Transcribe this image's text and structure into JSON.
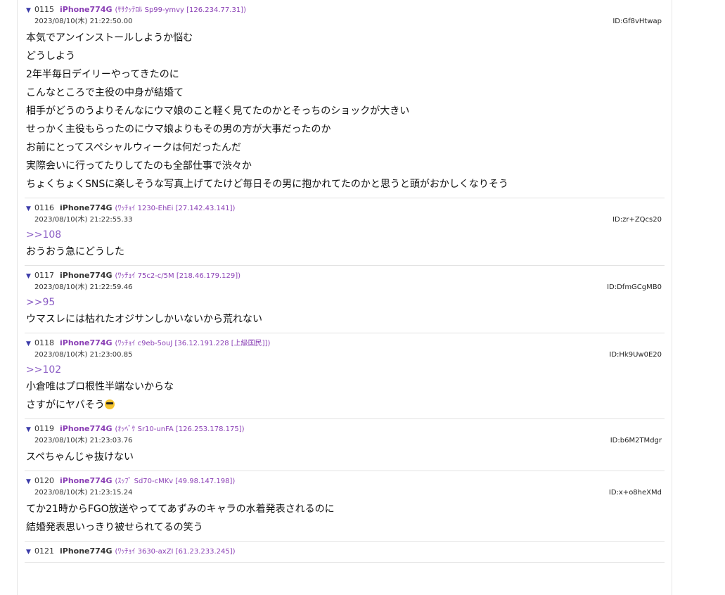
{
  "posts": [
    {
      "toggle": "▼",
      "number": "0115",
      "name": "iPhone774G",
      "trip": "(ｻｻｸｯﾃﾛﾙ Sp99-ymvy [126.234.77.31])",
      "date": "2023/08/10(木) 21:22:50.00",
      "id": "ID:Gf8vHtwap",
      "anchor": "",
      "lines": [
        "本気でアンインストールしようか悩む",
        "どうしよう",
        "2年半毎日デイリーやってきたのに",
        "こんなところで主役の中身が結婚て",
        "相手がどうのうよりそんなにウマ娘のこと軽く見てたのかとそっちのショックが大きい",
        "せっかく主役もらったのにウマ娘よりもその男の方が大事だったのか",
        "お前にとってスペシャルウィークは何だったんだ",
        "実際会いに行ってたりしてたのも全部仕事で渋々か",
        "ちょくちょくSNSに楽しそうな写真上げてたけど毎日その男に抱かれてたのかと思うと頭がおかしくなりそう"
      ]
    },
    {
      "toggle": "▼",
      "number": "0116",
      "name": "iPhone774G",
      "trip": "(ﾜｯﾁｮｲ 1230-EhEi [27.142.43.141])",
      "date": "2023/08/10(木) 21:22:55.33",
      "id": "ID:zr+ZQcs20",
      "anchor": ">>108",
      "lines": [
        "おうおう急にどうした"
      ]
    },
    {
      "toggle": "▼",
      "number": "0117",
      "name": "iPhone774G",
      "trip": "(ﾜｯﾁｮｲ 75c2-c/5M [218.46.179.129])",
      "date": "2023/08/10(木) 21:22:59.46",
      "id": "ID:DfmGCgMB0",
      "anchor": ">>95",
      "lines": [
        "ウマスレには枯れたオジサンしかいないから荒れない"
      ]
    },
    {
      "toggle": "▼",
      "number": "0118",
      "name": "iPhone774G",
      "trip": "(ﾜｯﾁｮｲ c9eb-5ouJ [36.12.191.228 [上級国民]])",
      "date": "2023/08/10(木) 21:23:00.85",
      "id": "ID:Hk9Uw0E20",
      "anchor": ">>102",
      "lines": [
        "小倉唯はプロ根性半端ないからな",
        "さすがにヤバそう"
      ],
      "emoji_line_index": 1,
      "emoji_icon": "sunglasses-face-icon"
    },
    {
      "toggle": "▼",
      "number": "0119",
      "name": "iPhone774G",
      "trip": "(ｵｯﾍﾟｹ Sr10-unFA [126.253.178.175])",
      "date": "2023/08/10(木) 21:23:03.76",
      "id": "ID:b6M2TMdgr",
      "anchor": "",
      "lines": [
        "スペちゃんじゃ抜けない"
      ]
    },
    {
      "toggle": "▼",
      "number": "0120",
      "name": "iPhone774G",
      "trip": "(ｽｯﾌﾟ Sd70-cMKv [49.98.147.198])",
      "date": "2023/08/10(木) 21:23:15.24",
      "id": "ID:x+o8heXMd",
      "anchor": "",
      "lines": [
        "てか21時からFGO放送やっててあずみのキャラの水着発表されるのに",
        "結婚発表思いっきり被せられてるの笑う"
      ]
    },
    {
      "toggle": "▼",
      "number": "0121",
      "name": "iPhone774G",
      "trip": "(ﾜｯﾁｮｲ 3630-axZI [61.23.233.245])",
      "date": "",
      "id": "",
      "anchor": "",
      "lines": []
    }
  ],
  "colors": {
    "name_accent": "#8a3fb5",
    "anchor": "#8a5cc4",
    "toggle": "#3a3aa8"
  }
}
